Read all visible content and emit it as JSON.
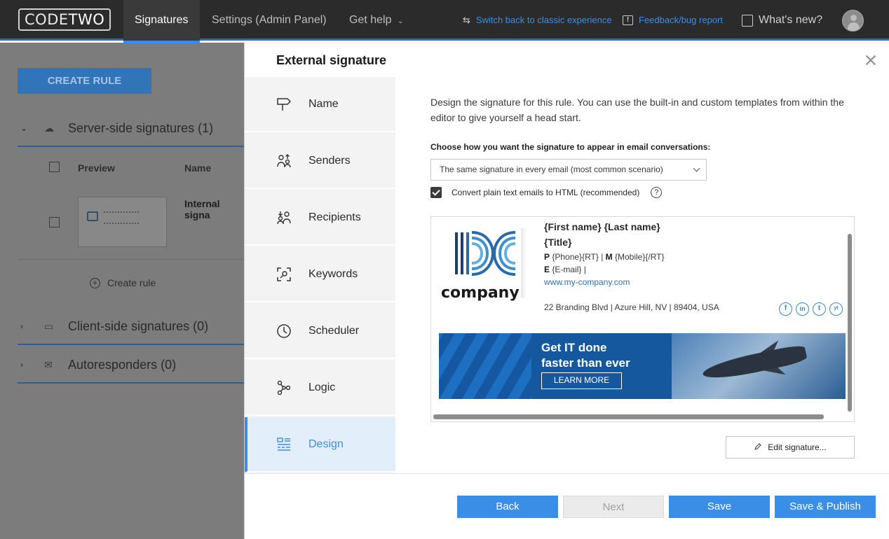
{
  "topbar": {
    "logo_code": "CODE",
    "logo_two": "TWO",
    "nav": [
      "Signatures",
      "Settings (Admin Panel)",
      "Get help"
    ],
    "switch_back": "Switch back to classic experience",
    "feedback": "Feedback/bug report",
    "whats_new": "What's new?"
  },
  "background": {
    "create_rule": "CREATE RULE",
    "sections": [
      {
        "label": "Server-side signatures (1)"
      },
      {
        "label": "Client-side signatures (0)"
      },
      {
        "label": "Autoresponders (0)"
      }
    ],
    "grid_headers": {
      "preview": "Preview",
      "name": "Name"
    },
    "row_name": "Internal signa",
    "create_rule_link": "Create rule"
  },
  "modal": {
    "title": "External signature",
    "steps": [
      {
        "label": "Name",
        "icon": "signpost-icon"
      },
      {
        "label": "Senders",
        "icon": "senders-icon"
      },
      {
        "label": "Recipients",
        "icon": "recipients-icon"
      },
      {
        "label": "Keywords",
        "icon": "keywords-icon"
      },
      {
        "label": "Scheduler",
        "icon": "clock-icon"
      },
      {
        "label": "Logic",
        "icon": "logic-icon"
      },
      {
        "label": "Design",
        "icon": "design-icon"
      }
    ],
    "description": "Design the signature for this rule. You can use the built-in and custom templates from within the editor to give yourself a head start.",
    "choose_label": "Choose how you want the signature to appear in email conversations:",
    "select_value": "The same signature in every email (most common scenario)",
    "checkbox_label": "Convert plain text emails to HTML (recommended)",
    "help": "?",
    "signature": {
      "company": "company",
      "name": "{First name} {Last name}",
      "title": "{Title}",
      "phone_p": "P",
      "phone_value": " {Phone}{RT} | ",
      "mobile_m": "M",
      "mobile_value": " {Mobile}{/RT}",
      "email_e": "E",
      "email_value": " {E-mail} |",
      "website": "www.my-company.com",
      "address": "22 Branding Blvd | Azure Hill, NV | 89404, USA",
      "social": [
        "f",
        "in",
        "t",
        "yt"
      ],
      "banner_line1": "Get IT done",
      "banner_line2": "faster than ever",
      "banner_button": "LEARN MORE"
    },
    "edit_signature": "Edit signature...",
    "buttons": {
      "back": "Back",
      "next": "Next",
      "save": "Save",
      "save_publish": "Save & Publish"
    }
  },
  "colors": {
    "accent": "#3a8ee6",
    "topbar": "#2b2b2b",
    "brand_blue": "#1f6fd1"
  }
}
